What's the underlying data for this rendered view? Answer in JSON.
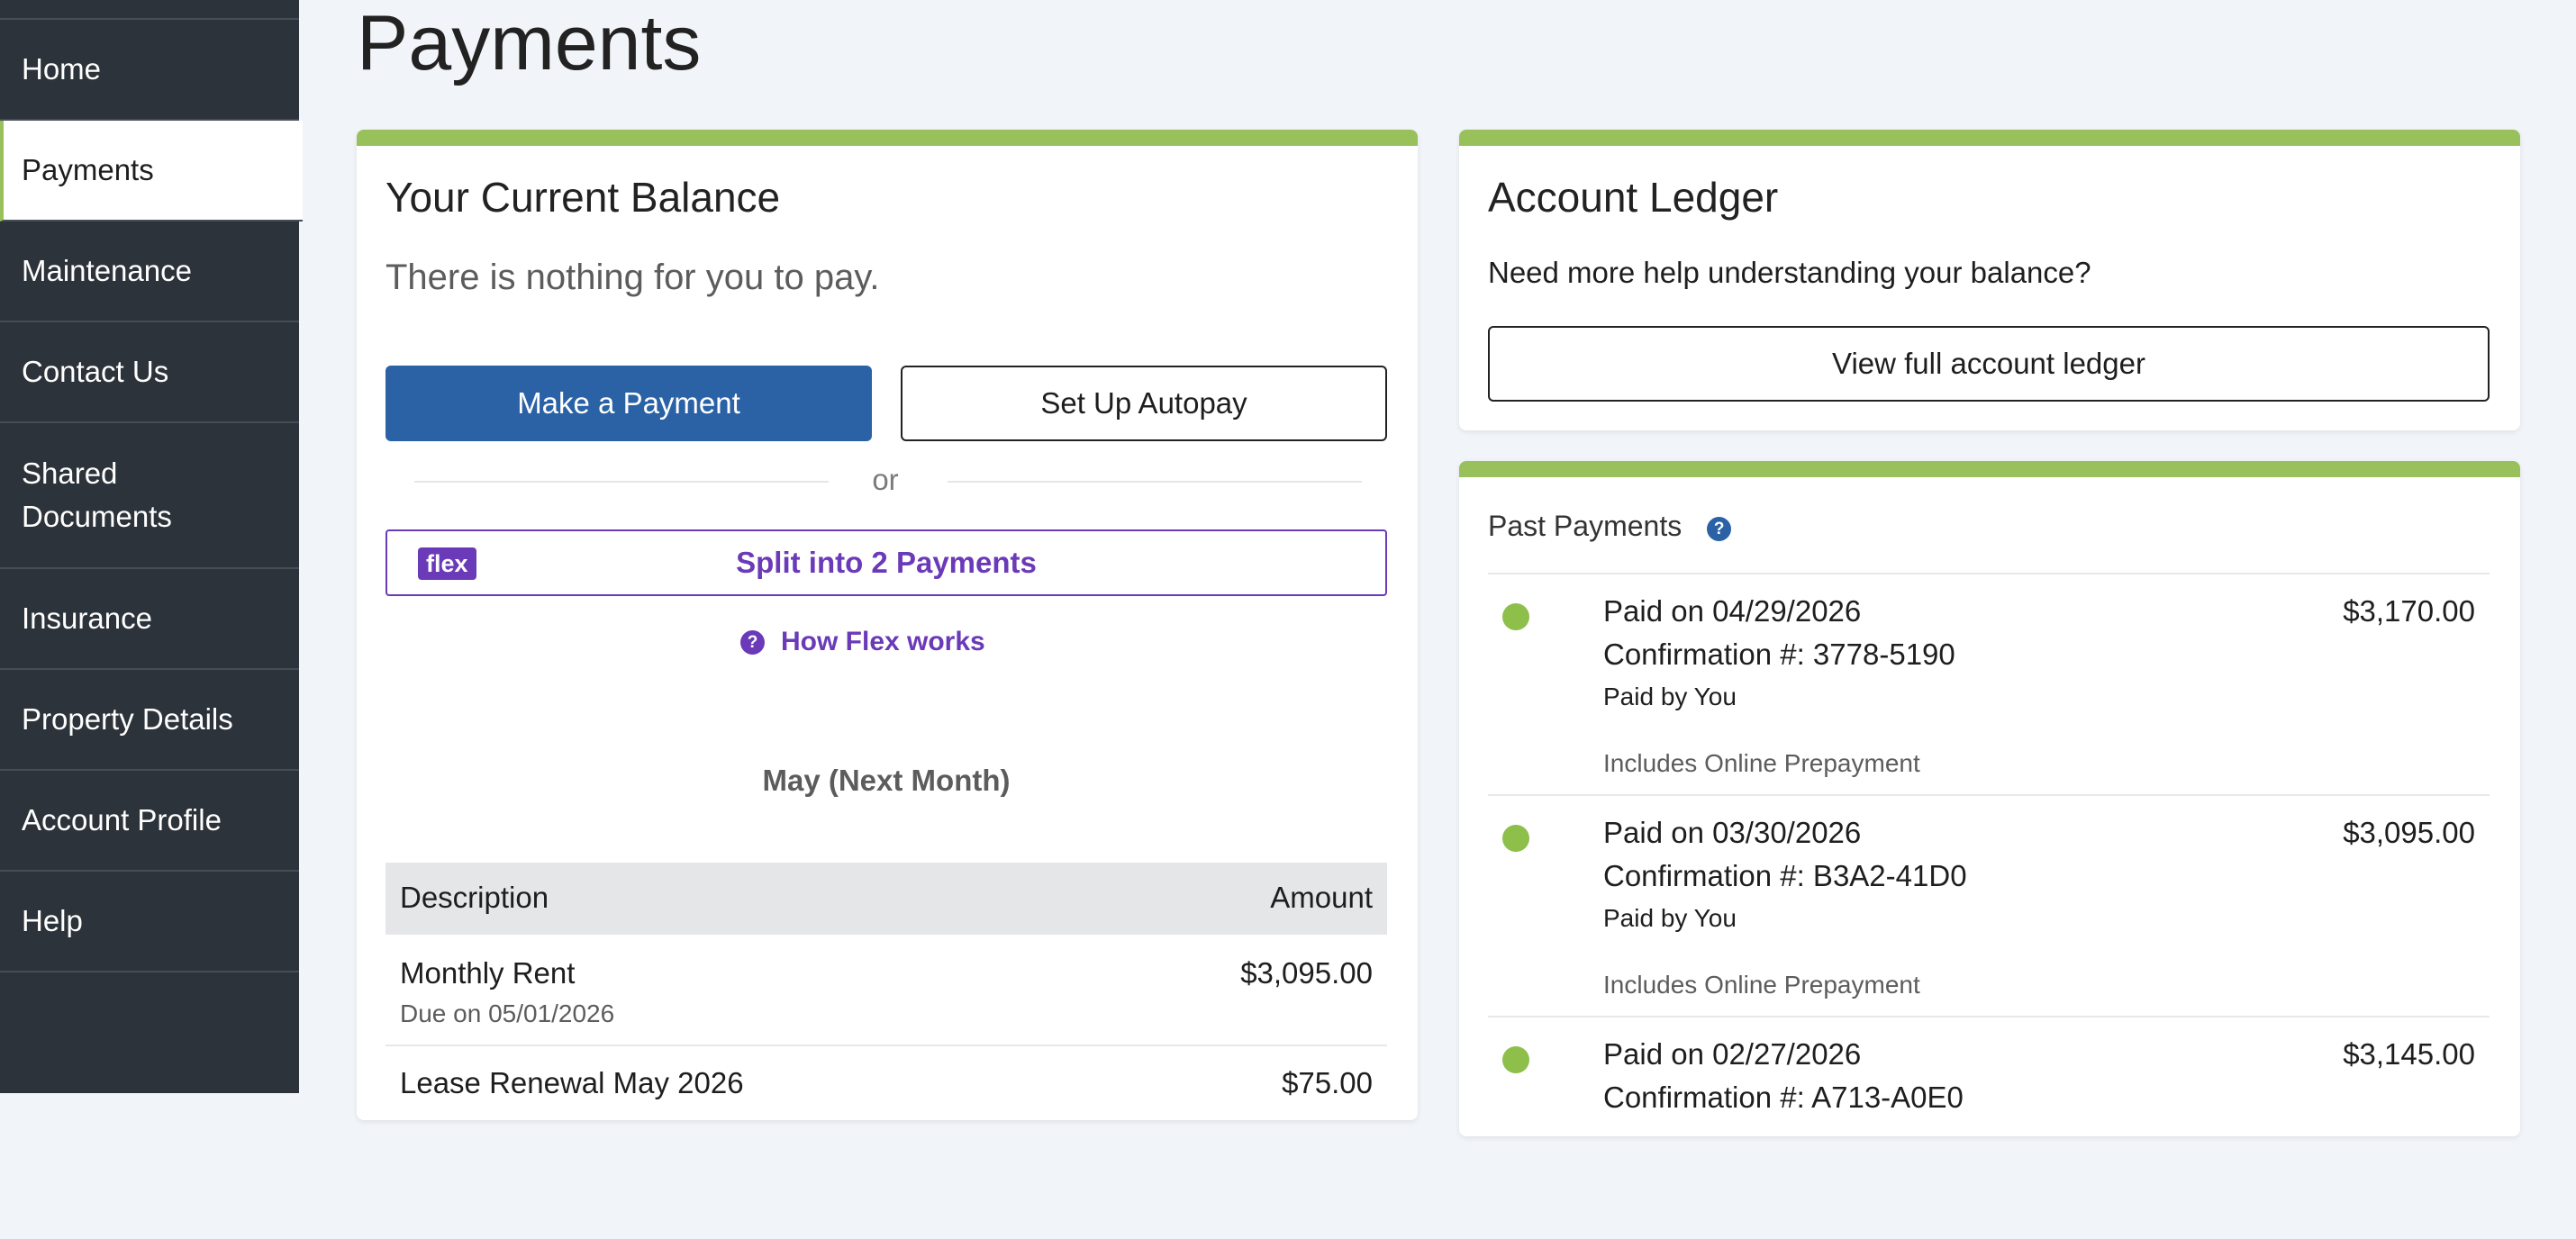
{
  "sidebar": {
    "items": [
      {
        "label": "Home"
      },
      {
        "label": "Payments"
      },
      {
        "label": "Maintenance"
      },
      {
        "label": "Contact Us"
      },
      {
        "label": "Shared Documents"
      },
      {
        "label": "Insurance"
      },
      {
        "label": "Property Details"
      },
      {
        "label": "Account Profile"
      },
      {
        "label": "Help"
      }
    ]
  },
  "page": {
    "title": "Payments"
  },
  "balance": {
    "title": "Your Current Balance",
    "message": "There is nothing for you to pay.",
    "make_payment_label": "Make a Payment",
    "autopay_label": "Set Up Autopay",
    "or_text": "or",
    "flex_badge": "flex",
    "flex_label": "Split into 2 Payments",
    "how_flex_label": "How Flex works",
    "how_flex_icon": "?",
    "month_heading": "May (Next Month)",
    "table": {
      "headers": {
        "description": "Description",
        "amount": "Amount"
      },
      "rows": [
        {
          "description": "Monthly Rent",
          "due": "Due on 05/01/2026",
          "amount": "$3,095.00"
        },
        {
          "description": "Lease Renewal May 2026",
          "due": "",
          "amount": "$75.00"
        }
      ]
    }
  },
  "ledger": {
    "title": "Account Ledger",
    "help_text": "Need more help understanding your balance?",
    "button_label": "View full account ledger"
  },
  "past_payments": {
    "title": "Past Payments",
    "help_icon": "?",
    "items": [
      {
        "date": "Paid on 04/29/2026",
        "confirmation": "Confirmation #: 3778-5190",
        "paid_by": "Paid by You",
        "note": "Includes Online Prepayment",
        "amount": "$3,170.00"
      },
      {
        "date": "Paid on 03/30/2026",
        "confirmation": "Confirmation #: B3A2-41D0",
        "paid_by": "Paid by You",
        "note": "Includes Online Prepayment",
        "amount": "$3,095.00"
      },
      {
        "date": "Paid on 02/27/2026",
        "confirmation": "Confirmation #: A713-A0E0",
        "paid_by": "",
        "note": "",
        "amount": "$3,145.00"
      }
    ]
  },
  "colors": {
    "accent_green": "#98c15b",
    "primary_blue": "#2b62a6",
    "flex_purple": "#6a3ab8",
    "sidebar_bg": "#2d333a",
    "status_dot": "#8dbf4a"
  }
}
